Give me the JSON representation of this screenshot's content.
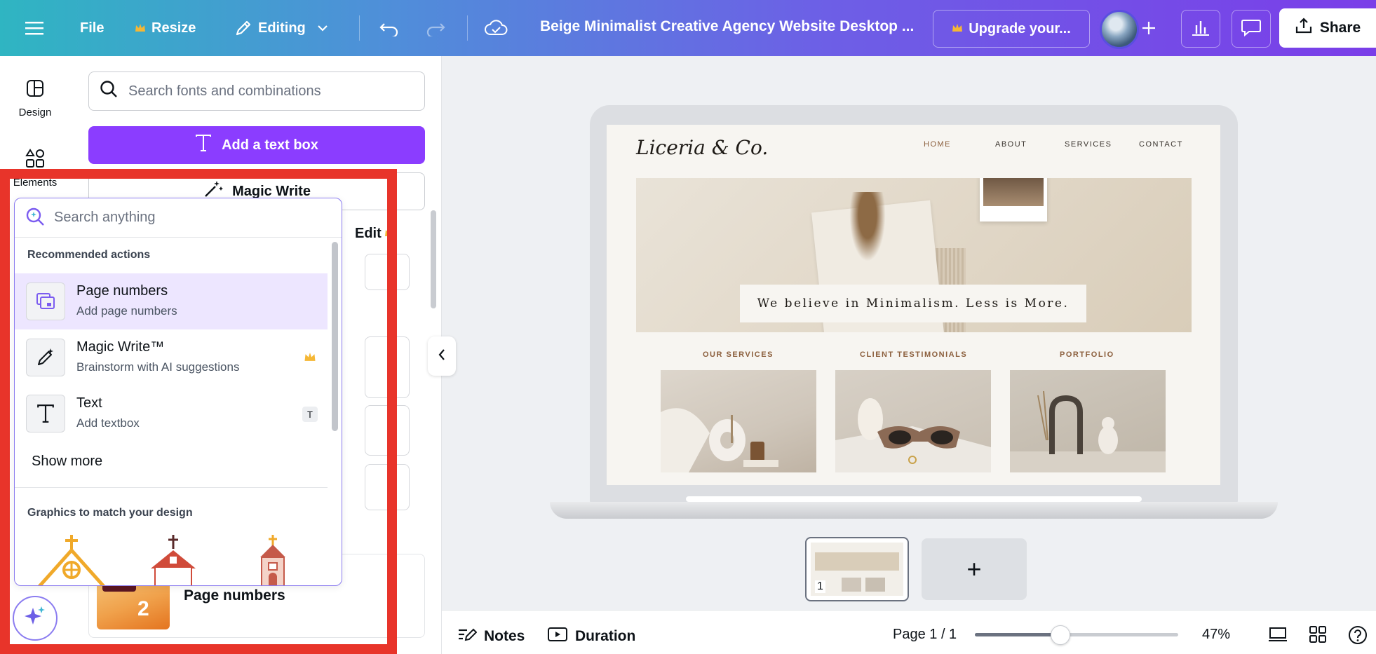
{
  "topbar": {
    "file": "File",
    "resize": "Resize",
    "editing": "Editing",
    "title": "Beige Minimalist Creative Agency Website Desktop ...",
    "upgrade": "Upgrade your...",
    "share": "Share"
  },
  "rail": {
    "design": "Design",
    "elements": "Elements"
  },
  "panel": {
    "search_placeholder": "Search fonts and combinations",
    "add_text_box": "Add a text box",
    "magic_write": "Magic Write",
    "edit": "Edit",
    "page_numbers_card": "Page numbers",
    "page_numbers_thumb": "2"
  },
  "popup": {
    "search_placeholder": "Search anything",
    "recommended_title": "Recommended actions",
    "items": [
      {
        "title": "Page numbers",
        "sub": "Add page numbers",
        "icon": "page-numbers-icon"
      },
      {
        "title": "Magic Write™",
        "sub": "Brainstorm with AI suggestions",
        "icon": "magic-pen-icon",
        "badge": "crown-icon"
      },
      {
        "title": "Text",
        "sub": "Add textbox",
        "icon": "text-icon",
        "shortcut": "T"
      }
    ],
    "show_more": "Show more",
    "graphics_title": "Graphics to match your design"
  },
  "site": {
    "logo": "Liceria & Co.",
    "nav": [
      "HOME",
      "ABOUT",
      "SERVICES",
      "CONTACT"
    ],
    "hero_caption": "We believe in Minimalism. Less is More.",
    "sections": [
      "OUR SERVICES",
      "CLIENT TESTIMONIALS",
      "PORTFOLIO"
    ]
  },
  "pages": {
    "thumb_number": "1",
    "add_page": "+"
  },
  "bottombar": {
    "notes": "Notes",
    "duration": "Duration",
    "page_indicator": "Page 1 / 1",
    "zoom": "47%",
    "zoom_fraction": 0.42
  },
  "colors": {
    "accent": "#8b3dff",
    "highlight": "#e8342a",
    "brown": "#8b5e3c"
  }
}
